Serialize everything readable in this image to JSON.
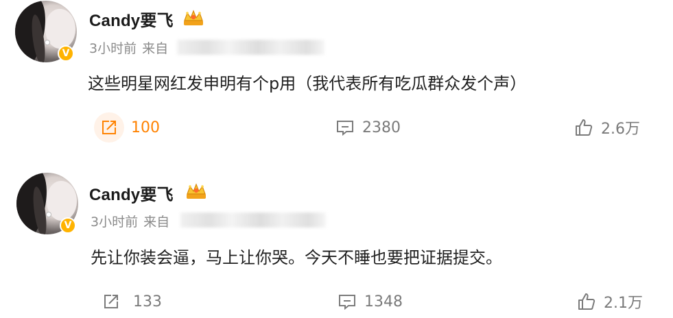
{
  "posts": [
    {
      "user": {
        "name": "Candy要飞",
        "verified_badge": "V"
      },
      "meta": {
        "time": "3小时前",
        "source_prefix": "来自"
      },
      "content": "这些明星网红发申明有个p用（我代表所有吃瓜群众发个声）",
      "actions": {
        "repost": {
          "icon": "share-icon",
          "count": "100",
          "active": true
        },
        "comment": {
          "icon": "comment-icon",
          "count": "2380"
        },
        "like": {
          "icon": "thumbs-up-icon",
          "count": "2.6万"
        }
      }
    },
    {
      "user": {
        "name": "Candy要飞",
        "verified_badge": "V"
      },
      "meta": {
        "time": "3小时前",
        "source_prefix": "来自"
      },
      "content": "先让你装会逼，马上让你哭。今天不睡也要把证据提交。",
      "actions": {
        "repost": {
          "icon": "share-icon",
          "count": "133",
          "active": false
        },
        "comment": {
          "icon": "comment-icon",
          "count": "1348"
        },
        "like": {
          "icon": "thumbs-up-icon",
          "count": "2.1万"
        }
      }
    }
  ],
  "colors": {
    "accent": "#ff8200",
    "badge": "#ffb300",
    "meta_text": "#8a8a8a",
    "action_text": "#7a7a7a"
  }
}
